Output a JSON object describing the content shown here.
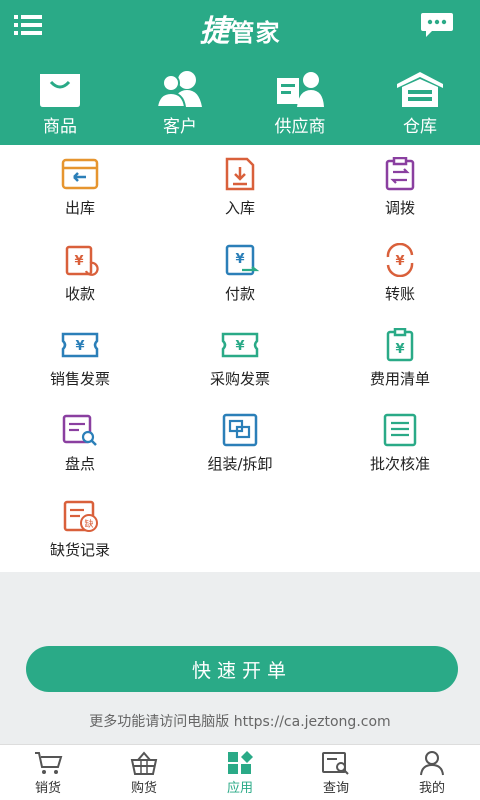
{
  "header": {
    "logo_char": "捷",
    "title": "管家"
  },
  "top_nav": [
    {
      "label": "商品",
      "icon": "shopping-bag-icon"
    },
    {
      "label": "客户",
      "icon": "users-icon"
    },
    {
      "label": "供应商",
      "icon": "supplier-icon"
    },
    {
      "label": "仓库",
      "icon": "warehouse-icon"
    }
  ],
  "functions": [
    {
      "label": "出库",
      "icon": "outbound-box-icon",
      "color": "#e6952f"
    },
    {
      "label": "入库",
      "icon": "inbound-doc-icon",
      "color": "#d9603b"
    },
    {
      "label": "调拨",
      "icon": "transfer-clipboard-icon",
      "color": "#8a3fa0"
    },
    {
      "label": "收款",
      "icon": "receive-payment-icon",
      "color": "#d9603b"
    },
    {
      "label": "付款",
      "icon": "make-payment-icon",
      "color": "#2b7fb8"
    },
    {
      "label": "转账",
      "icon": "transfer-money-icon",
      "color": "#d9603b"
    },
    {
      "label": "销售发票",
      "icon": "sales-invoice-icon",
      "color": "#2b7fb8"
    },
    {
      "label": "采购发票",
      "icon": "purchase-invoice-icon",
      "color": "#2aaa87"
    },
    {
      "label": "费用清单",
      "icon": "expense-list-icon",
      "color": "#2aaa87"
    },
    {
      "label": "盘点",
      "icon": "stocktake-icon",
      "color": "#8a3fa0"
    },
    {
      "label": "组装/拆卸",
      "icon": "assemble-icon",
      "color": "#2b7fb8"
    },
    {
      "label": "批次核准",
      "icon": "batch-approve-icon",
      "color": "#2aaa87"
    },
    {
      "label": "缺货记录",
      "icon": "shortage-record-icon",
      "color": "#d9603b",
      "badge": "缺"
    }
  ],
  "quick_order_label": "快速开单",
  "footer_note": "更多功能请访问电脑版 https://ca.jeztong.com",
  "bottom_nav": [
    {
      "label": "销货",
      "icon": "cart-icon"
    },
    {
      "label": "购货",
      "icon": "basket-icon"
    },
    {
      "label": "应用",
      "icon": "apps-icon",
      "active": true
    },
    {
      "label": "查询",
      "icon": "search-doc-icon"
    },
    {
      "label": "我的",
      "icon": "person-icon"
    }
  ],
  "colors": {
    "accent": "#2aaa87",
    "inactive": "#555555"
  }
}
